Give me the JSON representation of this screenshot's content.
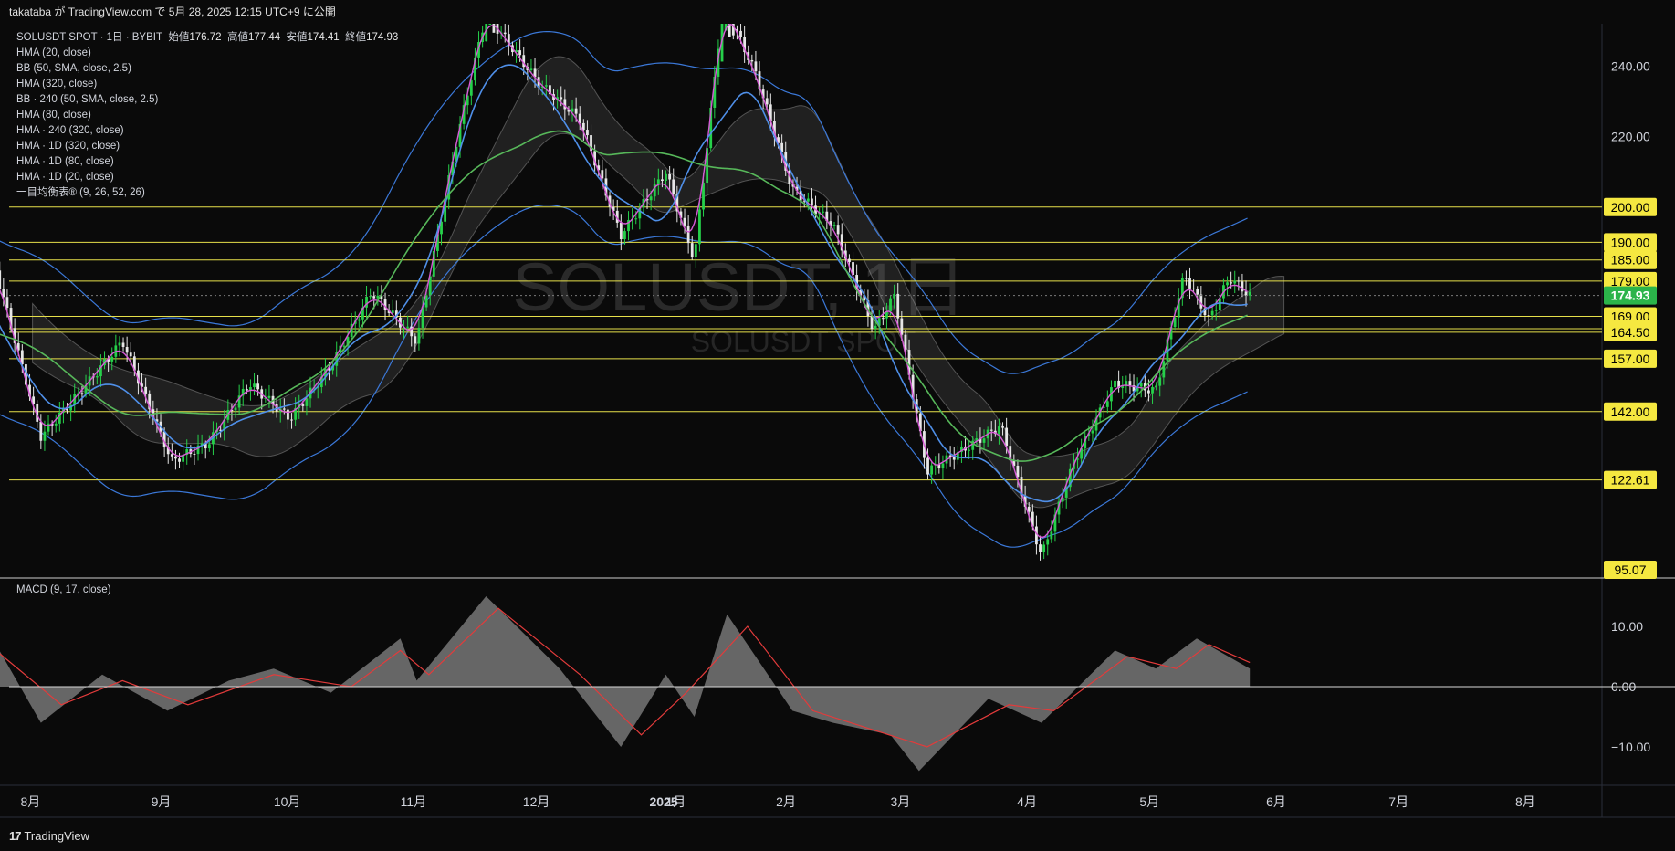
{
  "header": {
    "publish_line": "takataba が TradingView.com で 5月 28, 2025 12:15 UTC+9 に公開"
  },
  "footer": {
    "brand": "TradingView",
    "logo_glyph": "17"
  },
  "watermark": {
    "symbol": "SOLUSDT, 1日",
    "subtitle": "SOLUSDT SPOT"
  },
  "legend": {
    "symbol_line": "SOLUSDT SPOT · 1日 · BYBIT",
    "ohlc": [
      {
        "label": "始値",
        "value": "176.72"
      },
      {
        "label": "高値",
        "value": "177.44"
      },
      {
        "label": "安値",
        "value": "174.41"
      },
      {
        "label": "終値",
        "value": "174.93"
      }
    ],
    "indicators": [
      "HMA (20, close)",
      "BB (50, SMA, close, 2.5)",
      "HMA (320, close)",
      "BB · 240 (50, SMA, close, 2.5)",
      "HMA (80, close)",
      "HMA · 240 (320, close)",
      "HMA · 1D (320, close)",
      "HMA · 1D (80, close)",
      "HMA · 1D (20, close)",
      "一目均衡表® (9, 26, 52, 26)"
    ],
    "macd_label": "MACD (9, 17, close)"
  },
  "chart_data": [
    {
      "type": "candlestick",
      "title": "SOLUSDT SPOT · 1日 · BYBIT",
      "y_axis_ticks": [
        240,
        220,
        200,
        180,
        160,
        140,
        120
      ],
      "y_axis_tick_labels": [
        "240.00",
        "220.00"
      ],
      "ylim": [
        95.07,
        252
      ],
      "x_axis_labels": [
        "8月",
        "9月",
        "10月",
        "11月",
        "12月",
        "2025",
        "1月",
        "2月",
        "3月",
        "4月",
        "5月",
        "6月",
        "7月",
        "8月"
      ],
      "horizontal_levels": [
        200.0,
        190.0,
        185.0,
        179.0,
        169.0,
        165.5,
        164.5,
        157.0,
        142.0,
        122.61
      ],
      "level_labels": [
        "200.00",
        "190.00",
        "185.00",
        "179.00",
        "169.00",
        "165.50",
        "164.50",
        "157.00",
        "142.00",
        "122.61",
        "95.07"
      ],
      "last_price": 174.93,
      "last_price_label": "174.93",
      "price_path": [
        {
          "date": "2024-07-25",
          "close": 182
        },
        {
          "date": "2024-08-05",
          "close": 135
        },
        {
          "date": "2024-08-15",
          "close": 148
        },
        {
          "date": "2024-08-25",
          "close": 162
        },
        {
          "date": "2024-09-06",
          "close": 128
        },
        {
          "date": "2024-09-15",
          "close": 133
        },
        {
          "date": "2024-09-25",
          "close": 150
        },
        {
          "date": "2024-10-05",
          "close": 140
        },
        {
          "date": "2024-10-15",
          "close": 155
        },
        {
          "date": "2024-10-25",
          "close": 176
        },
        {
          "date": "2024-11-05",
          "close": 162
        },
        {
          "date": "2024-11-15",
          "close": 220
        },
        {
          "date": "2024-11-22",
          "close": 255
        },
        {
          "date": "2024-12-05",
          "close": 235
        },
        {
          "date": "2024-12-15",
          "close": 225
        },
        {
          "date": "2024-12-25",
          "close": 192
        },
        {
          "date": "2025-01-05",
          "close": 210
        },
        {
          "date": "2025-01-12",
          "close": 185
        },
        {
          "date": "2025-01-19",
          "close": 258
        },
        {
          "date": "2025-01-27",
          "close": 238
        },
        {
          "date": "2025-02-05",
          "close": 205
        },
        {
          "date": "2025-02-15",
          "close": 195
        },
        {
          "date": "2025-02-25",
          "close": 165
        },
        {
          "date": "2025-03-02",
          "close": 175
        },
        {
          "date": "2025-03-10",
          "close": 125
        },
        {
          "date": "2025-03-20",
          "close": 132
        },
        {
          "date": "2025-03-28",
          "close": 138
        },
        {
          "date": "2025-04-07",
          "close": 101
        },
        {
          "date": "2025-04-15",
          "close": 128
        },
        {
          "date": "2025-04-25",
          "close": 150
        },
        {
          "date": "2025-05-05",
          "close": 148
        },
        {
          "date": "2025-05-12",
          "close": 181
        },
        {
          "date": "2025-05-18",
          "close": 168
        },
        {
          "date": "2025-05-23",
          "close": 180
        },
        {
          "date": "2025-05-28",
          "close": 174.93
        }
      ]
    },
    {
      "type": "area",
      "title": "MACD (9, 17, close)",
      "y_axis_ticks": [
        10,
        0,
        -10
      ],
      "y_axis_tick_labels": [
        "10.00",
        "0.00",
        "−10.00"
      ],
      "ylim": [
        -16,
        18
      ],
      "series": [
        {
          "name": "MACD",
          "points": [
            {
              "date": "2024-07-25",
              "value": 7
            },
            {
              "date": "2024-08-05",
              "value": -6
            },
            {
              "date": "2024-08-20",
              "value": 2
            },
            {
              "date": "2024-09-05",
              "value": -4
            },
            {
              "date": "2024-09-20",
              "value": 1
            },
            {
              "date": "2024-10-01",
              "value": 3
            },
            {
              "date": "2024-10-15",
              "value": -1
            },
            {
              "date": "2024-11-01",
              "value": 8
            },
            {
              "date": "2024-11-05",
              "value": 1
            },
            {
              "date": "2024-11-22",
              "value": 15
            },
            {
              "date": "2024-12-10",
              "value": 3
            },
            {
              "date": "2024-12-25",
              "value": -10
            },
            {
              "date": "2025-01-05",
              "value": 2
            },
            {
              "date": "2025-01-12",
              "value": -5
            },
            {
              "date": "2025-01-20",
              "value": 12
            },
            {
              "date": "2025-02-05",
              "value": -4
            },
            {
              "date": "2025-02-15",
              "value": -6
            },
            {
              "date": "2025-03-01",
              "value": -8
            },
            {
              "date": "2025-03-08",
              "value": -14
            },
            {
              "date": "2025-03-25",
              "value": -2
            },
            {
              "date": "2025-04-07",
              "value": -6
            },
            {
              "date": "2025-04-25",
              "value": 6
            },
            {
              "date": "2025-05-05",
              "value": 3
            },
            {
              "date": "2025-05-15",
              "value": 8
            },
            {
              "date": "2025-05-28",
              "value": 3
            }
          ]
        },
        {
          "name": "Signal",
          "points": [
            {
              "date": "2024-07-25",
              "value": 6
            },
            {
              "date": "2024-08-10",
              "value": -3
            },
            {
              "date": "2024-08-25",
              "value": 1
            },
            {
              "date": "2024-09-10",
              "value": -3
            },
            {
              "date": "2024-10-01",
              "value": 2
            },
            {
              "date": "2024-10-20",
              "value": 0
            },
            {
              "date": "2024-11-01",
              "value": 6
            },
            {
              "date": "2024-11-08",
              "value": 2
            },
            {
              "date": "2024-11-25",
              "value": 13
            },
            {
              "date": "2024-12-15",
              "value": 2
            },
            {
              "date": "2024-12-30",
              "value": -8
            },
            {
              "date": "2025-01-10",
              "value": -1
            },
            {
              "date": "2025-01-25",
              "value": 10
            },
            {
              "date": "2025-02-10",
              "value": -4
            },
            {
              "date": "2025-03-10",
              "value": -10
            },
            {
              "date": "2025-03-30",
              "value": -3
            },
            {
              "date": "2025-04-10",
              "value": -4
            },
            {
              "date": "2025-04-28",
              "value": 5
            },
            {
              "date": "2025-05-10",
              "value": 3
            },
            {
              "date": "2025-05-18",
              "value": 7
            },
            {
              "date": "2025-05-28",
              "value": 4
            }
          ]
        }
      ]
    }
  ]
}
